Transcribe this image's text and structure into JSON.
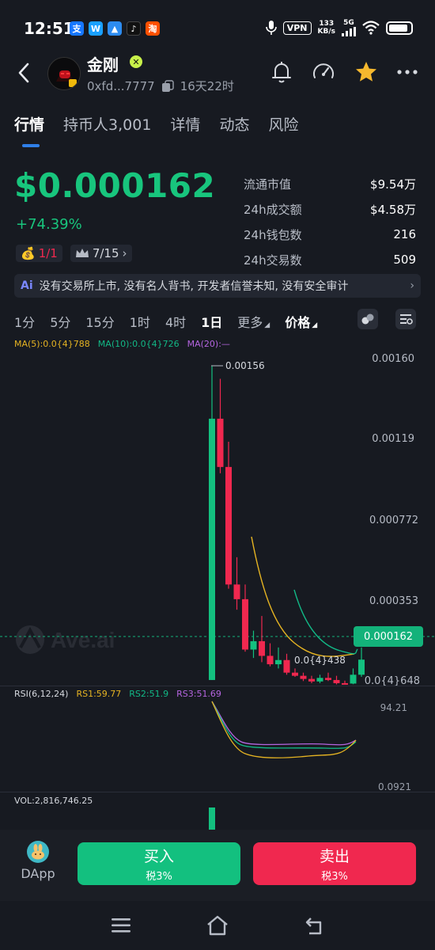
{
  "status_bar": {
    "time": "12:51",
    "apps": [
      "支",
      "W",
      "▲",
      "♪",
      "淘"
    ],
    "vpn": "VPN",
    "speed_top": "133",
    "speed_bottom": "KB/s",
    "network": "5G",
    "battery_level": 0.9
  },
  "header": {
    "token_name": "金刚",
    "address": "0xfd...7777",
    "age": "16天22时"
  },
  "tabs": [
    {
      "label": "行情",
      "active": true
    },
    {
      "label": "持币人3,001"
    },
    {
      "label": "详情"
    },
    {
      "label": "动态"
    },
    {
      "label": "风险"
    }
  ],
  "price": {
    "value": "$0.000162",
    "change": "+74.39%",
    "badge1": "1/1",
    "badge2": "7/15"
  },
  "stats": [
    {
      "label": "流通市值",
      "value": "$9.54万"
    },
    {
      "label": "24h成交额",
      "value": "$4.58万"
    },
    {
      "label": "24h钱包数",
      "value": "216"
    },
    {
      "label": "24h交易数",
      "value": "509"
    }
  ],
  "banner": {
    "icon": "Ai",
    "text": "没有交易所上市, 没有名人背书, 开发者信誉未知, 没有安全审计"
  },
  "timeframes": [
    "1分",
    "5分",
    "15分",
    "1时",
    "4时",
    "1日"
  ],
  "timeframe_selected": "1日",
  "more_label": "更多",
  "price_label": "价格",
  "ma": {
    "ma5": "MA(5):0.0{4}788",
    "ma10": "MA(10):0.0{4}726",
    "ma20": "MA(20):—"
  },
  "chart_data": {
    "type": "candlestick",
    "y_ticks": [
      "0.00160",
      "0.00119",
      "0.000772",
      "0.000353",
      "0.0{4}648"
    ],
    "max_label": "0.00156",
    "min_label": "0.0{4}438",
    "current_price_tag": "0.000162",
    "watermark": "Ave.ai",
    "candles": [
      {
        "o": 6.5e-05,
        "h": 0.00156,
        "l": 6.5e-05,
        "c": 0.00131
      },
      {
        "o": 0.00131,
        "h": 0.0015,
        "l": 0.00105,
        "c": 0.00108
      },
      {
        "o": 0.00108,
        "h": 0.0012,
        "l": 0.0005,
        "c": 0.00052
      },
      {
        "o": 0.00052,
        "h": 0.00065,
        "l": 0.0004,
        "c": 0.00045
      },
      {
        "o": 0.00045,
        "h": 0.00052,
        "l": 0.0002,
        "c": 0.00021
      },
      {
        "o": 0.00021,
        "h": 0.0003,
        "l": 0.00017,
        "c": 0.00025
      },
      {
        "o": 0.00025,
        "h": 0.00037,
        "l": 0.00015,
        "c": 0.00018
      },
      {
        "o": 0.00018,
        "h": 0.00024,
        "l": 0.00013,
        "c": 0.00014
      },
      {
        "o": 0.00014,
        "h": 0.00022,
        "l": 0.00012,
        "c": 0.00016
      },
      {
        "o": 0.00016,
        "h": 0.00019,
        "l": 9e-05,
        "c": 0.0001
      },
      {
        "o": 0.0001,
        "h": 0.00012,
        "l": 8e-05,
        "c": 8.5e-05
      },
      {
        "o": 8.5e-05,
        "h": 0.0001,
        "l": 6e-05,
        "c": 7e-05
      },
      {
        "o": 7e-05,
        "h": 8.5e-05,
        "l": 5e-05,
        "c": 5.8e-05
      },
      {
        "o": 5.8e-05,
        "h": 9e-05,
        "l": 5e-05,
        "c": 7.5e-05
      },
      {
        "o": 7.5e-05,
        "h": 0.0001,
        "l": 6e-05,
        "c": 6.5e-05
      },
      {
        "o": 6.5e-05,
        "h": 8.5e-05,
        "l": 4.4e-05,
        "c": 5e-05
      },
      {
        "o": 5e-05,
        "h": 6.2e-05,
        "l": 4.4e-05,
        "c": 4.8e-05
      },
      {
        "o": 4.8e-05,
        "h": 0.00012,
        "l": 4.5e-05,
        "c": 9e-05
      },
      {
        "o": 9e-05,
        "h": 0.00022,
        "l": 8e-05,
        "c": 0.000162
      }
    ]
  },
  "rsi": {
    "label": "RSI(6,12,24)",
    "rs1": "RS1:59.77",
    "rs2": "RS2:51.9",
    "rs3": "RS3:51.69",
    "top": "94.21",
    "bottom": "0.0921"
  },
  "volume": {
    "label": "VOL:2,816,746.25"
  },
  "bottom_bar": {
    "dapp_label": "DApp",
    "buy_label": "买入",
    "buy_tax": "税3%",
    "sell_label": "卖出",
    "sell_tax": "税3%"
  },
  "colors": {
    "up": "#13c07f",
    "down": "#f0284f",
    "ma5": "#e6b422",
    "ma10": "#12b886",
    "ma20": "#b565e0"
  }
}
